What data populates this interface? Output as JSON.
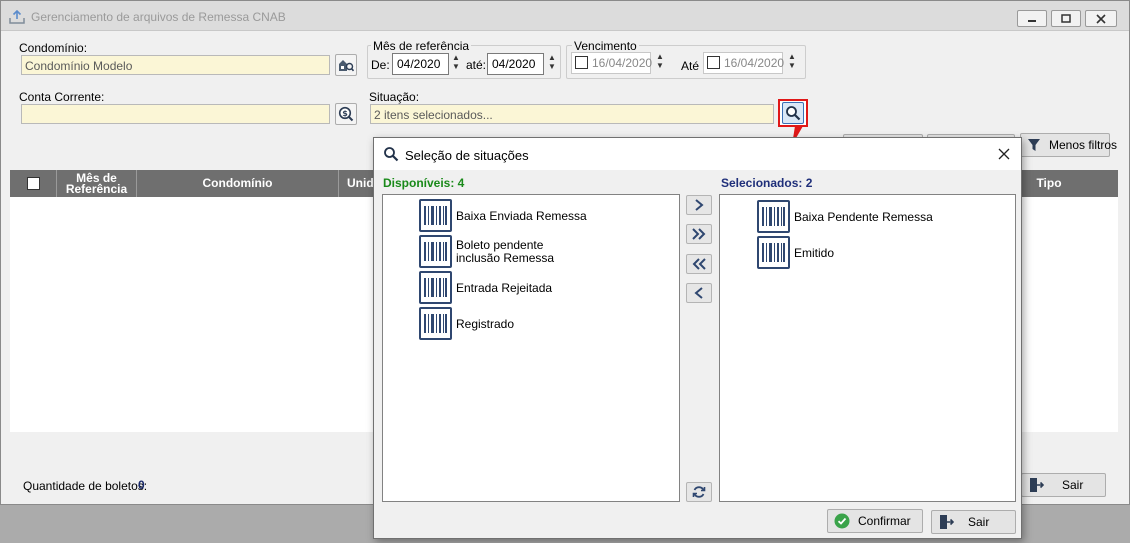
{
  "window": {
    "title": "Gerenciamento de arquivos de Remessa CNAB"
  },
  "filters": {
    "condominio_label": "Condomínio:",
    "condominio_value": "Condomínio Modelo",
    "mes_ref": {
      "title": "Mês de referência",
      "de_label": "De:",
      "de_value": "04/2020",
      "ate_label": "até:",
      "ate_value": "04/2020"
    },
    "vencimento": {
      "title": "Vencimento",
      "from_value": "16/04/2020",
      "ate_label": "Até",
      "to_value": "16/04/2020"
    },
    "conta_label": "Conta Corrente:",
    "conta_value": "",
    "situacao_label": "Situação:",
    "situacao_value": "2 itens selecionados...",
    "menos_filtros": "Menos filtros"
  },
  "grid": {
    "columns": [
      "Mês de Referência",
      "Condomínio",
      "Unid",
      "Tipo"
    ]
  },
  "footer": {
    "quantidade_label": "Quantidade de boletos:",
    "quantidade_value": "0",
    "sair": "Sair"
  },
  "dialog": {
    "title": "Seleção de situações",
    "available_label": "Disponíveis: 4",
    "selected_label": "Selecionados: 2",
    "available": [
      {
        "label": "Baixa Enviada Remessa",
        "icon": "barcode-icon"
      },
      {
        "label": "Boleto pendente inclusão Remessa",
        "icon": "barcode-icon"
      },
      {
        "label": "Entrada Rejeitada",
        "icon": "barcode-icon"
      },
      {
        "label": "Registrado",
        "icon": "barcode-icon"
      }
    ],
    "selected": [
      {
        "label": "Baixa Pendente Remessa",
        "icon": "barcode-icon"
      },
      {
        "label": "Emitido",
        "icon": "barcode-icon"
      }
    ],
    "confirm": "Confirmar",
    "exit": "Sair"
  },
  "colors": {
    "available_label": "#1a8a1a",
    "selected_label": "#1f2f7a",
    "field_bg": "#fbf6d6",
    "highlight": "#e01818"
  }
}
